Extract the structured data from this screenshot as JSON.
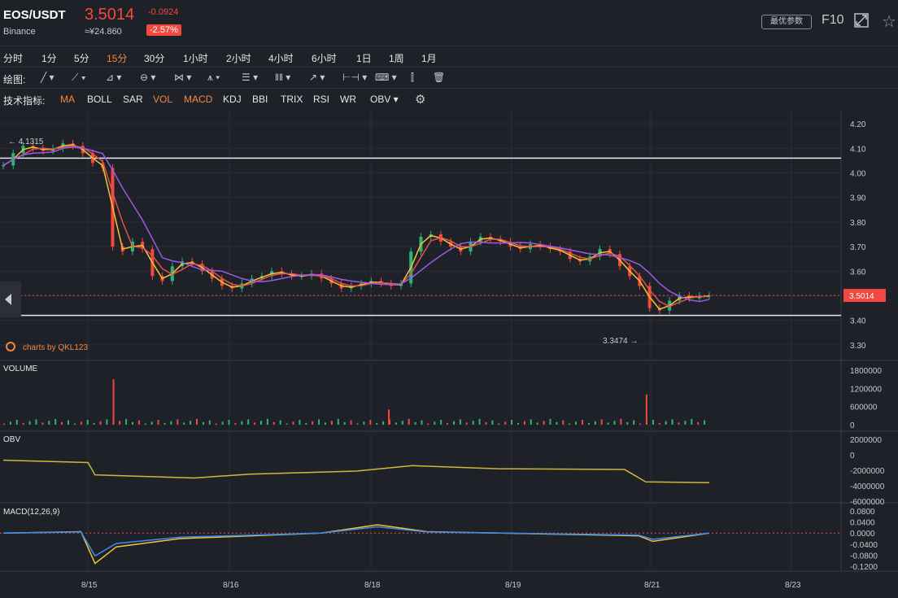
{
  "header": {
    "symbol": "EOS/USDT",
    "exchange": "Binance",
    "price": "3.5014",
    "cny_price": "≈¥24.860",
    "change": "-0.0924",
    "change_pct": "-2.57%",
    "optimal_params_label": "最优参数",
    "f10_label": "F10"
  },
  "timeframes": [
    {
      "label": "分时",
      "active": false
    },
    {
      "label": "1分",
      "active": false
    },
    {
      "label": "5分",
      "active": false
    },
    {
      "label": "15分",
      "active": true
    },
    {
      "label": "30分",
      "active": false
    },
    {
      "label": "1小时",
      "active": false
    },
    {
      "label": "2小时",
      "active": false
    },
    {
      "label": "4小时",
      "active": false
    },
    {
      "label": "6小时",
      "active": false
    },
    {
      "label": "1日",
      "active": false
    },
    {
      "label": "1周",
      "active": false
    },
    {
      "label": "1月",
      "active": false
    }
  ],
  "drawing": {
    "label": "绘图:"
  },
  "indicators": {
    "label": "技术指标:",
    "items": [
      {
        "label": "MA",
        "active": true
      },
      {
        "label": "BOLL",
        "active": false
      },
      {
        "label": "SAR",
        "active": false
      },
      {
        "label": "VOL",
        "active": true
      },
      {
        "label": "MACD",
        "active": true
      },
      {
        "label": "KDJ",
        "active": false
      },
      {
        "label": "BBI",
        "active": false
      },
      {
        "label": "TRIX",
        "active": false
      },
      {
        "label": "RSI",
        "active": false
      },
      {
        "label": "WR",
        "active": false
      },
      {
        "label": "OBV ▾",
        "active": false
      }
    ]
  },
  "colors": {
    "up": "#2bb57b",
    "down": "#f1493f",
    "accent": "#f4863c",
    "ma_fast": "#f4c430",
    "ma_mid": "#e0524d",
    "ma_slow": "#9b59e8",
    "obv": "#d4b53a",
    "macd_dif": "#f4c430",
    "macd_dea": "#3a8df0"
  },
  "chart_data": {
    "type": "line",
    "title": "EOS/USDT",
    "watermark": "charts by QKL123",
    "price_axis": {
      "ticks": [
        "4.20",
        "4.10",
        "4.00",
        "3.90",
        "3.80",
        "3.70",
        "3.60",
        "3.50",
        "3.40",
        "3.30"
      ],
      "ylim": [
        3.27,
        4.22
      ]
    },
    "x_ticks": [
      "8/15",
      "8/16",
      "8/18",
      "8/19",
      "8/21",
      "8/23"
    ],
    "current_price_label": "3.5014",
    "high_label": "← 4.1315",
    "low_label": "3.3474 →",
    "horizontal_levels": [
      4.06,
      3.42
    ],
    "current_price": 3.5014,
    "price_series": [
      4.03,
      4.08,
      4.11,
      4.1,
      4.09,
      4.1,
      4.12,
      4.11,
      4.08,
      4.04,
      4.02,
      3.7,
      3.68,
      3.72,
      3.69,
      3.58,
      3.56,
      3.62,
      3.64,
      3.63,
      3.6,
      3.57,
      3.54,
      3.53,
      3.55,
      3.57,
      3.58,
      3.6,
      3.59,
      3.58,
      3.58,
      3.59,
      3.57,
      3.55,
      3.53,
      3.54,
      3.55,
      3.56,
      3.55,
      3.54,
      3.55,
      3.68,
      3.74,
      3.75,
      3.72,
      3.7,
      3.68,
      3.72,
      3.74,
      3.73,
      3.72,
      3.7,
      3.69,
      3.71,
      3.7,
      3.69,
      3.68,
      3.65,
      3.64,
      3.66,
      3.69,
      3.67,
      3.62,
      3.58,
      3.54,
      3.45,
      3.44,
      3.48,
      3.5,
      3.49,
      3.5,
      3.5
    ],
    "volume": {
      "label": "VOLUME",
      "ticks": [
        "1800000",
        "1200000",
        "600000",
        "0"
      ],
      "spikes": [
        [
          0.155,
          1500000
        ],
        [
          0.545,
          500000
        ],
        [
          0.91,
          1000000
        ]
      ]
    },
    "obv": {
      "label": "OBV",
      "ticks": [
        "2000000",
        "0",
        "-2000000",
        "-4000000",
        "-6000000"
      ]
    },
    "macd": {
      "label": "MACD(12,26,9)",
      "ticks": [
        "0.0800",
        "0.0400",
        "0.0000",
        "-0.0400",
        "-0.0800",
        "-0.1200"
      ]
    }
  }
}
